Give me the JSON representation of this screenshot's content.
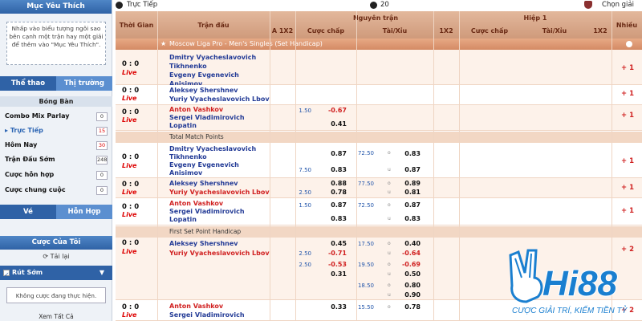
{
  "sidebar": {
    "favorites_title": "Mục Yêu Thích",
    "favorites_hint": "Nhấp vào biểu tượng ngôi sao bên cạnh một trận hay một giải để thêm vào \"Mục Yêu Thích\".",
    "tabs": [
      "Thể thao",
      "Thị trường"
    ],
    "sport": "Bóng Bàn",
    "menu": [
      {
        "label": "Combo Mix Parlay",
        "count": "0",
        "red": false
      },
      {
        "label": "Trực Tiếp",
        "count": "15",
        "red": true,
        "active": true
      },
      {
        "label": "Hôm Nay",
        "count": "30",
        "red": true
      },
      {
        "label": "Trận Đấu Sớm",
        "count": "248",
        "red": false
      },
      {
        "label": "Cược hỗn hợp",
        "count": "0",
        "red": false
      },
      {
        "label": "Cược chung cuộc",
        "count": "0",
        "red": false
      }
    ],
    "ve_tabs": [
      "Vé",
      "Hỗn Hợp"
    ],
    "my_bets": "Cược Của Tôi",
    "reload": "Tải lại",
    "cashout": "Rút Sớm",
    "no_bets": "Không cược đang thực hiện.",
    "view_all": "Xem Tất Cả"
  },
  "topbar": {
    "live_label": "Trực Tiếp",
    "count": "20",
    "choose_league": "Chọn giải"
  },
  "header": {
    "time": "Thời Gian",
    "match": "Trận đấu",
    "full_match": "Nguyên trận",
    "half1": "Hiệp 1",
    "more": "Nhiều",
    "sub": [
      "A 1X2",
      "Cược chấp",
      "Tài/Xỉu",
      "1X2",
      "Cược chấp",
      "Tài/Xỉu",
      "1X2"
    ]
  },
  "league": "Moscow Liga Pro - Men's Singles (Set Handicap)",
  "sections": [
    "Total Match Points",
    "First Set Point Handicap"
  ],
  "matches": [
    {
      "score": "0 : 0",
      "live": "Live",
      "teams": [
        "Dmitry Vyacheslavovich Tikhnenko",
        "Evgeny Evgenevich Anisimov"
      ],
      "more": "+ 1"
    },
    {
      "score": "0 : 0",
      "live": "Live",
      "teams": [
        "Aleksey Shershnev",
        "Yuriy Vyacheslavovich Lbov"
      ],
      "more": "+ 1"
    },
    {
      "score": "0 : 0",
      "live": "Live",
      "teams": [
        "Anton Vashkov",
        "Sergei Vladimirovich Lopatin"
      ],
      "hdp": "1.50",
      "o1": "-0.67",
      "o2": "0.41",
      "more": "+ 1"
    },
    {
      "score": "0 : 0",
      "live": "Live",
      "teams": [
        "Dmitry Vyacheslavovich Tikhnenko",
        "Evgeny Evgenevich Anisimov"
      ],
      "hdp": "7.50",
      "o1": "0.87",
      "o2": "0.83",
      "ou": "72.50",
      "u1": "0.83",
      "u2": "0.87",
      "more": "+ 1"
    },
    {
      "score": "0 : 0",
      "live": "Live",
      "teams": [
        "Aleksey Shershnev",
        "Yuriy Vyacheslavovich Lbov"
      ],
      "hdp": "2.50",
      "o1": "0.88",
      "o2": "0.78",
      "ou": "77.50",
      "u1": "0.89",
      "u2": "0.81",
      "more": "+ 1"
    },
    {
      "score": "0 : 0",
      "live": "Live",
      "teams": [
        "Anton Vashkov",
        "Sergei Vladimirovich Lopatin"
      ],
      "hdp": "1.50",
      "o1": "0.87",
      "o2": "0.83",
      "ou": "72.50",
      "u1": "0.87",
      "u2": "0.83",
      "more": "+ 1"
    },
    {
      "score": "0 : 0",
      "live": "Live",
      "teams": [
        "Aleksey Shershnev",
        "Yuriy Vyacheslavovich Lbov"
      ],
      "more": "+ 2",
      "lines": [
        {
          "hdp": "",
          "o": "0.45",
          "ou": "17.50",
          "u": "0.40"
        },
        {
          "hdp": "2.50",
          "o": "-0.71",
          "ou": "",
          "u": "-0.64"
        },
        {
          "hdp": "2.50",
          "o": "-0.53",
          "ou": "19.50",
          "u": "-0.69"
        },
        {
          "hdp": "",
          "o": "0.31",
          "ou": "",
          "u": "0.50"
        },
        {
          "hdp": "",
          "o": "",
          "ou": "18.50",
          "u": "0.80"
        },
        {
          "hdp": "",
          "o": "",
          "ou": "",
          "u": "0.90"
        }
      ]
    },
    {
      "score": "0 : 0",
      "live": "Live",
      "teams": [
        "Anton Vashkov",
        "Sergei Vladimirovich"
      ],
      "o1": "0.33",
      "ou": "15.50",
      "u1": "0.78",
      "more": "+ 2"
    }
  ],
  "brand": {
    "name": "Hi88",
    "slogan": "CƯỢC GIẢI TRÍ, KIẾM TIỀN TỶ"
  }
}
